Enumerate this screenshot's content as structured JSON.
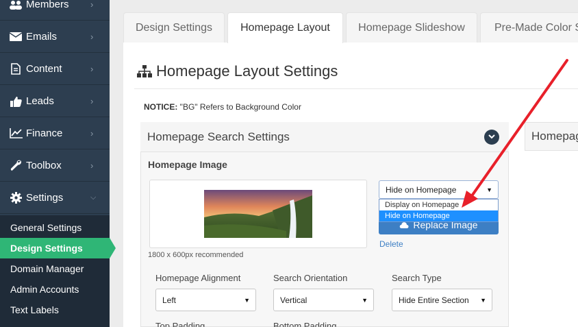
{
  "sidebar": {
    "items": [
      {
        "label": "Members",
        "icon": "members-icon"
      },
      {
        "label": "Emails",
        "icon": "email-icon"
      },
      {
        "label": "Content",
        "icon": "document-icon"
      },
      {
        "label": "Leads",
        "icon": "thumbs-up-icon"
      },
      {
        "label": "Finance",
        "icon": "chart-line-icon"
      },
      {
        "label": "Toolbox",
        "icon": "wrench-icon"
      },
      {
        "label": "Settings",
        "icon": "gear-icon"
      }
    ],
    "submenu": [
      "General Settings",
      "Design Settings",
      "Domain Manager",
      "Admin Accounts",
      "Text Labels"
    ],
    "active_submenu": "Design Settings"
  },
  "tabs": [
    {
      "label": "Design Settings"
    },
    {
      "label": "Homepage Layout"
    },
    {
      "label": "Homepage Slideshow"
    },
    {
      "label": "Pre-Made Color Sc"
    }
  ],
  "active_tab": "Homepage Layout",
  "page": {
    "title": "Homepage Layout Settings",
    "notice_bold": "NOTICE:",
    "notice_text": " \"BG\" Refers to Background Color"
  },
  "search_section": {
    "header": "Homepage Search Settings",
    "right_header": "Homepag",
    "image_label": "Homepage Image",
    "image_caption": "1800 x 600px recommended",
    "display_select": {
      "value": "Hide on Homepage",
      "options": [
        "Display on Homepage",
        "Hide on Homepage"
      ],
      "highlighted": "Hide on Homepage"
    },
    "replace_button": "Replace Image",
    "delete_link": "Delete",
    "fields": [
      {
        "label": "Homepage Alignment",
        "value": "Left"
      },
      {
        "label": "Search Orientation",
        "value": "Vertical"
      },
      {
        "label": "Search Type",
        "value": "Hide Entire Section"
      }
    ],
    "padding_labels": [
      "Top Padding",
      "Bottom Padding"
    ]
  },
  "colors": {
    "sidebar_bg": "#2d3e50",
    "submenu_bg": "#1f2b38",
    "active_green": "#2fb676",
    "button_blue": "#3d7fc4",
    "highlight_blue": "#1e90ff",
    "annotation_red": "#e8202a"
  }
}
